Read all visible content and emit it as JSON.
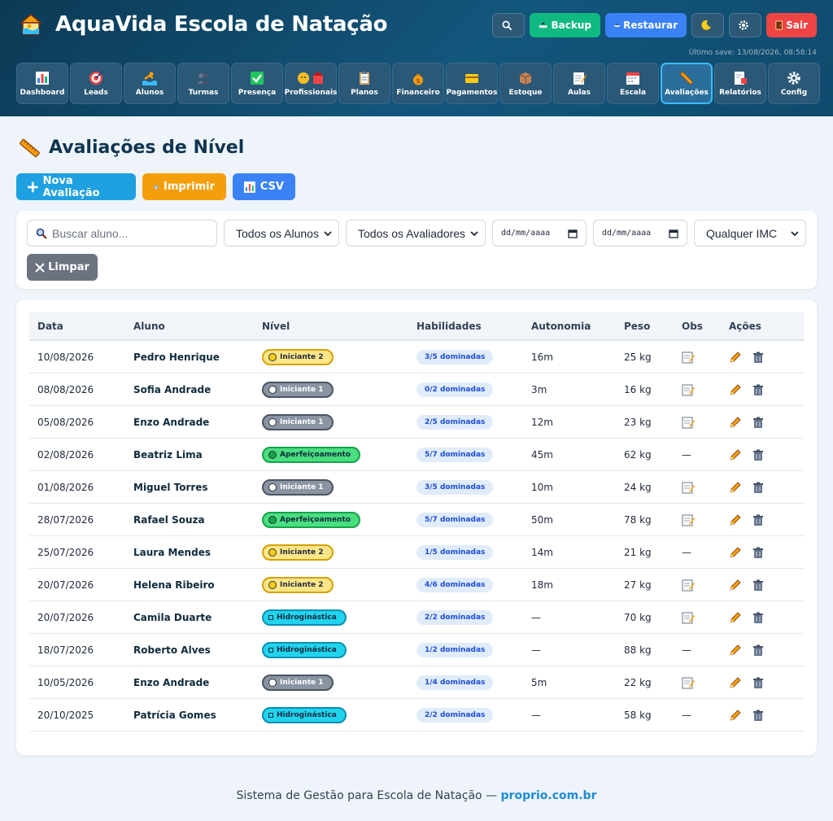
{
  "app": {
    "title": "AquaVida Escola de Natação",
    "last_save": "Último save: 13/08/2026, 08:58:14"
  },
  "top_actions": {
    "backup": "Backup",
    "restore": "Restaurar",
    "logout": "Sair"
  },
  "nav": [
    {
      "label": "Dashboard",
      "icon": "chart-icon"
    },
    {
      "label": "Leads",
      "icon": "target-icon"
    },
    {
      "label": "Alunos",
      "icon": "swimmer-icon"
    },
    {
      "label": "Turmas",
      "icon": "people-icon"
    },
    {
      "label": "Presença",
      "icon": "check-icon"
    },
    {
      "label": "Profissionais",
      "icon": "teacher-icon"
    },
    {
      "label": "Planos",
      "icon": "clipboard-icon"
    },
    {
      "label": "Financeiro",
      "icon": "money-bag-icon"
    },
    {
      "label": "Pagamentos",
      "icon": "credit-card-icon"
    },
    {
      "label": "Estoque",
      "icon": "box-icon"
    },
    {
      "label": "Aulas",
      "icon": "memo-icon"
    },
    {
      "label": "Escala",
      "icon": "calendar-icon"
    },
    {
      "label": "Avaliações",
      "icon": "ruler-icon",
      "active": true
    },
    {
      "label": "Relatórios",
      "icon": "report-icon"
    },
    {
      "label": "Config",
      "icon": "gear-icon"
    }
  ],
  "page": {
    "title": "Avaliações de Nível"
  },
  "actions": {
    "new": "Nova Avaliação",
    "print": "Imprimir",
    "csv": "CSV"
  },
  "filters": {
    "search_placeholder": "Buscar aluno...",
    "students": "Todos os Alunos",
    "evaluators": "Todos os Avaliadores",
    "date_from": "dd/mm/aaaa",
    "date_to": "dd/mm/aaaa",
    "imc": "Qualquer IMC",
    "clear": "Limpar"
  },
  "table": {
    "headers": [
      "Data",
      "Aluno",
      "Nível",
      "Habilidades",
      "Autonomia",
      "Peso",
      "Obs",
      "Ações"
    ],
    "rows": [
      {
        "date": "10/08/2026",
        "student": "Pedro Henrique",
        "level": "Iniciante 2",
        "level_color": "yellow",
        "skills": "3/5 dominadas",
        "autonomy": "16m",
        "weight": "25 kg",
        "obs": true
      },
      {
        "date": "08/08/2026",
        "student": "Sofia Andrade",
        "level": "Iniciante 1",
        "level_color": "gray",
        "skills": "0/2 dominadas",
        "autonomy": "3m",
        "weight": "16 kg",
        "obs": true
      },
      {
        "date": "05/08/2026",
        "student": "Enzo Andrade",
        "level": "Iniciante 1",
        "level_color": "gray",
        "skills": "2/5 dominadas",
        "autonomy": "12m",
        "weight": "23 kg",
        "obs": true
      },
      {
        "date": "02/08/2026",
        "student": "Beatriz Lima",
        "level": "Aperfeiçoamento",
        "level_color": "green",
        "skills": "5/7 dominadas",
        "autonomy": "45m",
        "weight": "62 kg",
        "obs": false
      },
      {
        "date": "01/08/2026",
        "student": "Miguel Torres",
        "level": "Iniciante 1",
        "level_color": "gray",
        "skills": "3/5 dominadas",
        "autonomy": "10m",
        "weight": "24 kg",
        "obs": true
      },
      {
        "date": "28/07/2026",
        "student": "Rafael Souza",
        "level": "Aperfeiçoamento",
        "level_color": "green",
        "skills": "5/7 dominadas",
        "autonomy": "50m",
        "weight": "78 kg",
        "obs": true
      },
      {
        "date": "25/07/2026",
        "student": "Laura Mendes",
        "level": "Iniciante 2",
        "level_color": "yellow",
        "skills": "1/5 dominadas",
        "autonomy": "14m",
        "weight": "21 kg",
        "obs": false
      },
      {
        "date": "20/07/2026",
        "student": "Helena Ribeiro",
        "level": "Iniciante 2",
        "level_color": "yellow",
        "skills": "4/6 dominadas",
        "autonomy": "18m",
        "weight": "27 kg",
        "obs": true
      },
      {
        "date": "20/07/2026",
        "student": "Camila Duarte",
        "level": "Hidroginástica",
        "level_color": "cyan",
        "skills": "2/2 dominadas",
        "autonomy": "—",
        "weight": "70 kg",
        "obs": true
      },
      {
        "date": "18/07/2026",
        "student": "Roberto Alves",
        "level": "Hidroginástica",
        "level_color": "cyan",
        "skills": "1/2 dominadas",
        "autonomy": "—",
        "weight": "88 kg",
        "obs": false
      },
      {
        "date": "10/05/2026",
        "student": "Enzo Andrade",
        "level": "Iniciante 1",
        "level_color": "gray",
        "skills": "1/4 dominadas",
        "autonomy": "5m",
        "weight": "22 kg",
        "obs": true
      },
      {
        "date": "20/10/2025",
        "student": "Patrícia Gomes",
        "level": "Hidroginástica",
        "level_color": "cyan",
        "skills": "2/2 dominadas",
        "autonomy": "—",
        "weight": "58 kg",
        "obs": false
      }
    ],
    "empty_obs": "—"
  },
  "footer": {
    "text": "Sistema de Gestão para Escola de Natação  —",
    "link": "proprio.com.br"
  },
  "colors": {
    "header_bg": "#0b3a55",
    "accent": "#1fa0e0",
    "active_nav_border": "#38bdf8"
  }
}
